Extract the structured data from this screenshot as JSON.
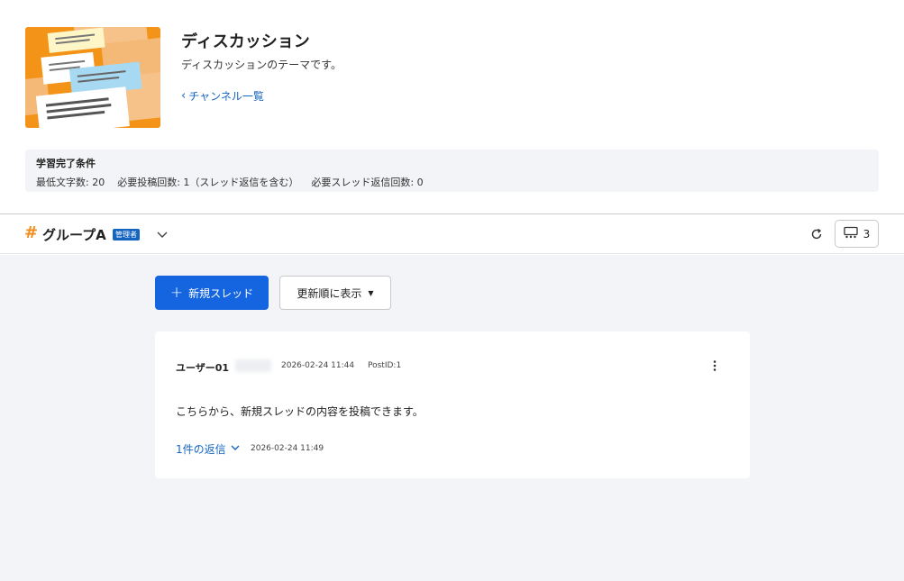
{
  "header": {
    "title": "ディスカッション",
    "description": "ディスカッションのテーマです。",
    "back_link": "チャンネル一覧"
  },
  "completion": {
    "title": "学習完了条件",
    "items": [
      "最低文字数: 20",
      "必要投稿回数: 1（スレッド返信を含む）",
      "必要スレッド返信回数: 0"
    ]
  },
  "group": {
    "name": "グループA",
    "badge": "管理者",
    "member_count": "3"
  },
  "toolbar": {
    "new_thread_label": "新規スレッド",
    "sort_label": "更新順に表示"
  },
  "post": {
    "author": "ユーザー01",
    "date": "2026-02-24 11:44",
    "post_id": "PostID:1",
    "content": "こちらから、新規スレッドの内容を投稿できます。",
    "replies_label": "1件の返信",
    "reply_date": "2026-02-24 11:49"
  },
  "colors": {
    "accent": "#1565e0",
    "link": "#1565c0",
    "hash": "#f08c1a",
    "background": "#f3f4f7"
  }
}
